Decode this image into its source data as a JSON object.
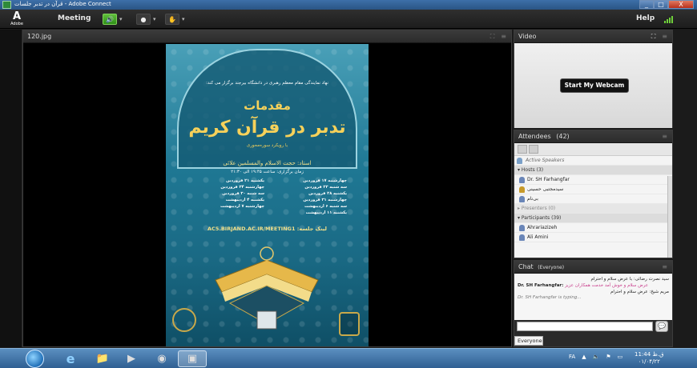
{
  "window": {
    "title": "قرآن در تدبر جلسات - Adobe Connect",
    "controls": [
      "_",
      "□",
      "X"
    ]
  },
  "appbar": {
    "logo_text": "Adobe",
    "meeting_menu": "Meeting",
    "help": "Help",
    "toolbar_icons": [
      "speaker-icon",
      "webcam-icon",
      "raise-hand-icon"
    ]
  },
  "share_pod": {
    "title": "120.jpg",
    "poster": {
      "intro": "نهاد نمایندگی مقام معظم رهبری در دانشگاه بیرجند برگزار می کند:",
      "title_top": "مقدمات",
      "title_main": "تدبر در قرآن کریم",
      "subtitle": "با رویکرد سوره‌محوری",
      "teacher": "استاد: حجت الاسلام والمسلمین علائی",
      "time": "زمان برگزاری: ساعت ۱۹:۴۵ الی ۲۱:۳۰",
      "sessions": [
        "چهارشنبه ۱۷ فروردین",
        "یکشنبه ۲۱ فروردین",
        "سه شنبه ۲۳ فروردین",
        "چهارشنبه ۲۴ فروردین",
        "یکشنبه ۲۸ فروردین",
        "سه شنبه ۳۰ فروردین",
        "چهارشنبه ۳۱ فروردین",
        "یکشنبه ۴ اردیبهشت",
        "سه شنبه ۶ اردیبهشت",
        "چهارشنبه ۷ اردیبهشت",
        "یکشنبه ۱۱ اردیبهشت"
      ],
      "link": "AC5.BIRJAND.AC.IR/MEETING1 :لینک جلسه"
    }
  },
  "video_pod": {
    "title": "Video",
    "webcam_button": "Start My Webcam"
  },
  "attendees_pod": {
    "title": "Attendees",
    "count": "(42)",
    "active_speakers": "Active Speakers",
    "hosts_header": "Hosts (3)",
    "hosts": [
      "Dr. SH Farhangfar",
      "سیدمجتبی حسینی",
      "بی‌نام"
    ],
    "presenters_header": "Presenters (0)",
    "participants_header": "Participants (39)",
    "participants": [
      "Ahrariazizeh",
      "Ali Amini"
    ]
  },
  "chat_pod": {
    "title": "Chat",
    "scope": "(Everyone)",
    "messages": [
      "سید نصرت رضائی: با عرض سلام و احترام",
      "Dr. SH Farhangfar:",
      "عرض سلام و خوش آمد خدمت همکاران عزیز",
      "مریم شیخ: عرض سلام و احترام"
    ],
    "typing": "Dr. SH Farhangfar is typing...",
    "tab": "Everyone"
  },
  "taskbar": {
    "lang": "FA",
    "time": "11:44 ق.ظ",
    "date": "۰۱/۰۴/۲۲"
  },
  "colors": {
    "accent_green": "#3aa81f",
    "poster_teal": "#1f7894",
    "taskbar_blue": "#3a6ea5"
  }
}
